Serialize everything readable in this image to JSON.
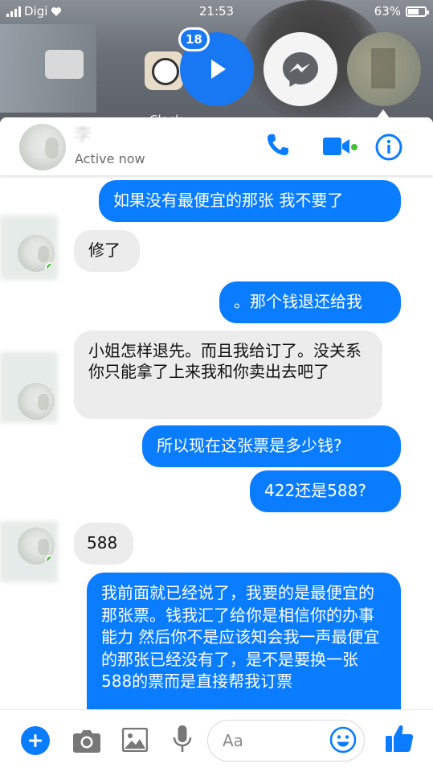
{
  "status_bar": {
    "carrier": "Digi",
    "time": "21:53",
    "battery": "63%",
    "battery_level": 0.63
  },
  "home_screen": {
    "clock_label": "Clock"
  },
  "chat_heads": {
    "unread_badge": "18"
  },
  "header": {
    "contact_name": "李",
    "status": "Active now"
  },
  "messages": [
    {
      "direction": "out",
      "text": "如果没有最便宜的那张 我不要了"
    },
    {
      "direction": "in",
      "text": "修了"
    },
    {
      "direction": "out",
      "text": "。那个钱退还给我"
    },
    {
      "direction": "in",
      "text": "小姐怎样退先。而且我给订了。没关系你只能拿了上来我和你卖出去吧了"
    },
    {
      "direction": "out",
      "text": "所以现在这张票是多少钱?"
    },
    {
      "direction": "out",
      "text": "422还是588?"
    },
    {
      "direction": "in",
      "text": "588"
    },
    {
      "direction": "out",
      "text": "我前面就已经说了，我要的是最便宜的那张票。钱我汇了给你是相信你的办事能力 然后你不是应该知会我一声最便宜的那张已经没有了，是不是要换一张588的票而是直接帮我订票"
    }
  ],
  "composer": {
    "placeholder": "Aa"
  },
  "colors": {
    "accent": "#0a7cff",
    "incoming_bubble": "#ececec",
    "online": "#44bd32"
  }
}
